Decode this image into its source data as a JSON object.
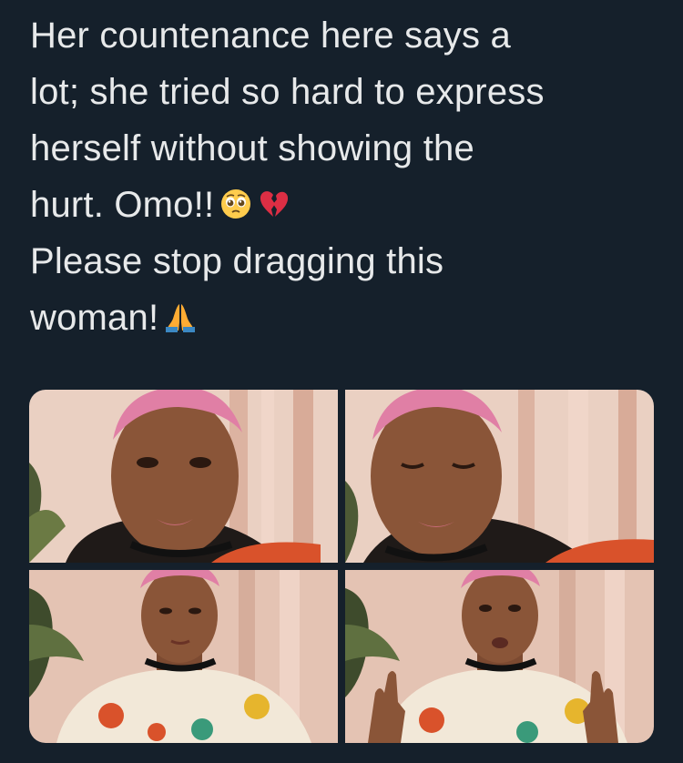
{
  "tweet": {
    "lines": [
      "Her countenance here says a",
      "lot; she tried so hard to express",
      "herself without showing the",
      "hurt. Omo!!",
      "Please stop dragging this",
      "woman!"
    ],
    "emojis": {
      "line4": [
        "pleading-face-emoji",
        "broken-heart-emoji"
      ],
      "line6": [
        "folded-hands-emoji"
      ]
    }
  },
  "media": {
    "count": 4,
    "photos": [
      {
        "name": "photo-1",
        "description_icon": "woman-portrait-photo"
      },
      {
        "name": "photo-2",
        "description_icon": "woman-portrait-photo"
      },
      {
        "name": "photo-3",
        "description_icon": "woman-portrait-photo"
      },
      {
        "name": "photo-4",
        "description_icon": "woman-portrait-photo"
      }
    ]
  },
  "colors": {
    "background": "#15202b",
    "text": "#e7e9ea",
    "hair": "#e07fa5",
    "skin": "#8a5538",
    "curtain": "#e8c1ad"
  }
}
